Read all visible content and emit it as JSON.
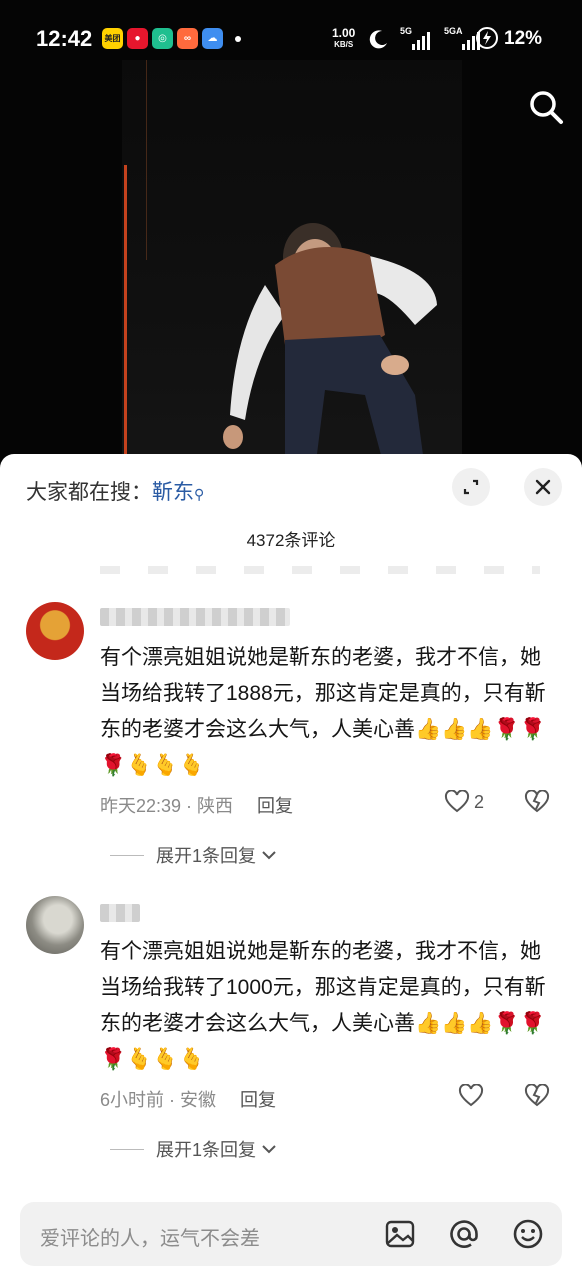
{
  "status_bar": {
    "time": "12:42",
    "net_speed_value": "1.00",
    "net_speed_unit": "KB/S",
    "signal1_label": "5G",
    "signal2_label": "5GA",
    "battery": "12%",
    "app_icons": [
      "meituan-icon",
      "weibo-icon",
      "camera-app-icon",
      "grid-app-icon",
      "weather-icon"
    ],
    "meituan_label": "美团"
  },
  "sheet": {
    "hot_search_prefix": "大家都在搜：",
    "hot_search_keyword": "靳东",
    "comment_count": "4372条评论"
  },
  "comments": [
    {
      "text": "有个漂亮姐姐说她是靳东的老婆，我才不信，她当场给我转了1888元，那这肯定是真的，只有靳东的老婆才会这么大气，人美心善",
      "emojis": "👍👍👍🌹🌹🌹🫰🫰🫰",
      "time": "昨天22:39",
      "location": "陕西",
      "reply_label": "回复",
      "likes": "2",
      "expand_label": "展开1条回复"
    },
    {
      "text": "有个漂亮姐姐说她是靳东的老婆，我才不信，她当场给我转了1000元，那这肯定是真的，只有靳东的老婆才会这么大气，人美心善",
      "emojis": "👍👍👍🌹🌹🌹🫰🫰🫰",
      "time": "6小时前",
      "location": "安徽",
      "reply_label": "回复",
      "likes": "",
      "expand_label": "展开1条回复"
    }
  ],
  "input": {
    "placeholder": "爱评论的人，运气不会差"
  },
  "colors": {
    "accent_link": "#2a5ba4",
    "sheet_bg": "#ffffff"
  }
}
